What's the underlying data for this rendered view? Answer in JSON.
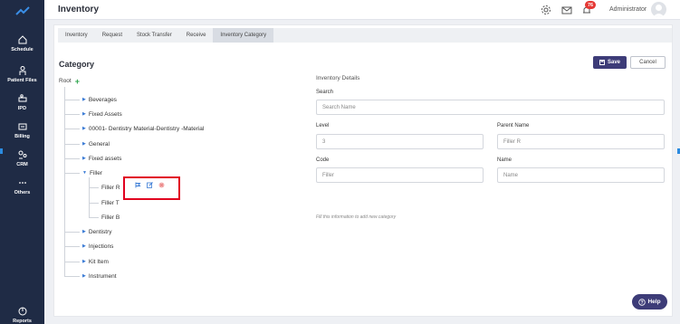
{
  "sidebar": {
    "items": [
      {
        "label": "Schedule",
        "icon": "home-icon"
      },
      {
        "label": "Patient Files",
        "icon": "person-icon"
      },
      {
        "label": "IPD",
        "icon": "bed-icon"
      },
      {
        "label": "Billing",
        "icon": "billing-icon"
      },
      {
        "label": "CRM",
        "icon": "crm-icon"
      },
      {
        "label": "Others",
        "icon": "more-icon"
      },
      {
        "label": "Reports",
        "icon": "reports-icon"
      }
    ]
  },
  "header": {
    "title": "Inventory",
    "notification_count": "76",
    "user": "Administrator"
  },
  "tabs": [
    {
      "label": "Inventory"
    },
    {
      "label": "Request"
    },
    {
      "label": "Stock Transfer"
    },
    {
      "label": "Receive"
    },
    {
      "label": "Inventory Category",
      "active": true
    }
  ],
  "category": {
    "title": "Category",
    "save_label": "Save",
    "cancel_label": "Cancel",
    "root_label": "Root",
    "nodes": [
      {
        "label": "Beverages"
      },
      {
        "label": "Fixed Assets"
      },
      {
        "label": "00001- Dentistry Material-Dentistry -Material"
      },
      {
        "label": "General"
      },
      {
        "label": "Fixed assets"
      },
      {
        "label": "Filler",
        "expanded": true
      },
      {
        "label": "Dentistry"
      },
      {
        "label": "Injections"
      },
      {
        "label": "Kit Item"
      },
      {
        "label": "Instrument"
      }
    ],
    "filler_children": [
      {
        "label": "Filler R"
      },
      {
        "label": "Filler T"
      },
      {
        "label": "Filler B"
      }
    ]
  },
  "details": {
    "title": "Inventory Details",
    "search_label": "Search",
    "search_placeholder": "Search Name",
    "level_label": "Level",
    "level_value": "3",
    "parent_label": "Parent Name",
    "parent_value": "Filler R",
    "code_label": "Code",
    "code_value": "Filler",
    "name_label": "Name",
    "name_placeholder": "Name",
    "hint": "Fill this information to add new category"
  },
  "help_label": "Help",
  "colors": {
    "sidebar": "#1f2b45",
    "accent": "#3d3c78",
    "highlight": "#e1001f"
  }
}
